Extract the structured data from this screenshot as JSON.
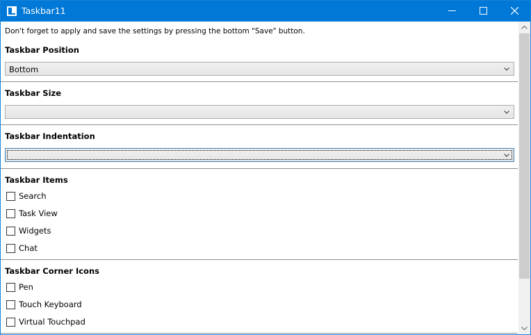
{
  "window": {
    "title": "Taskbar11"
  },
  "notice": "Don't forget to apply and save the settings by pressing the bottom \"Save\" button.",
  "sections": {
    "position": {
      "title": "Taskbar Position",
      "selected": "Bottom"
    },
    "size": {
      "title": "Taskbar Size",
      "selected": ""
    },
    "indentation": {
      "title": "Taskbar Indentation",
      "selected": ""
    },
    "items": {
      "title": "Taskbar Items",
      "options": [
        {
          "label": "Search",
          "checked": false
        },
        {
          "label": "Task View",
          "checked": false
        },
        {
          "label": "Widgets",
          "checked": false
        },
        {
          "label": "Chat",
          "checked": false
        }
      ]
    },
    "corner_icons": {
      "title": "Taskbar Corner Icons",
      "options": [
        {
          "label": "Pen",
          "checked": false
        },
        {
          "label": "Touch Keyboard",
          "checked": false
        },
        {
          "label": "Virtual Touchpad",
          "checked": false
        }
      ]
    }
  },
  "colors": {
    "titlebar": "#0078d7",
    "accent_border": "#1883d7"
  },
  "icons": {
    "app": "taskbar-app-icon",
    "minimize": "minimize-icon",
    "maximize": "maximize-icon",
    "close": "close-icon",
    "dropdown": "chevron-down-icon",
    "scroll_up": "chevron-up-icon",
    "scroll_down": "chevron-down-icon"
  }
}
